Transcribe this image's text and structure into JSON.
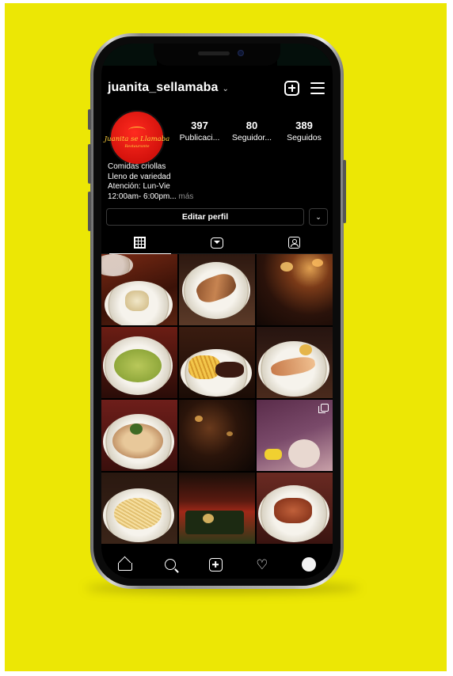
{
  "profile": {
    "username": "juanita_sellamaba",
    "avatar_logo_text": "Juanita se Llamaba",
    "avatar_logo_sub": "Restaurante",
    "brand_color": "#e3150e"
  },
  "stats": [
    {
      "value": "397",
      "label": "Publicaci..."
    },
    {
      "value": "80",
      "label": "Seguidor..."
    },
    {
      "value": "389",
      "label": "Seguidos"
    }
  ],
  "bio": {
    "line1": "Comidas criollas",
    "line2": "Lleno de variedad",
    "line3": "Atención: Lun-Vie",
    "line4": "12:00am- 6:00pm...",
    "more": " más"
  },
  "actions": {
    "edit_profile": "Editar perfil"
  },
  "tabs": [
    {
      "icon": "grid-icon",
      "active": true
    },
    {
      "icon": "igtv-icon",
      "active": false
    },
    {
      "icon": "tagged-icon",
      "active": false
    }
  ],
  "feed": {
    "columns": 3,
    "items": [
      {
        "subject": "rice dish on white plate"
      },
      {
        "subject": "crepes with sauce"
      },
      {
        "subject": "restaurant interior at night"
      },
      {
        "subject": "green risotto"
      },
      {
        "subject": "steak with fries"
      },
      {
        "subject": "fish fillet with potatoes"
      },
      {
        "subject": "tart on plate"
      },
      {
        "subject": "dark bar interior"
      },
      {
        "subject": "event poster",
        "multiple": true
      },
      {
        "subject": "pasta in soup plate"
      },
      {
        "subject": "restaurant storefront"
      },
      {
        "subject": "meat with vegetables"
      }
    ]
  },
  "bottom_nav": [
    "home-icon",
    "search-icon",
    "new-post-icon",
    "activity-icon",
    "profile-avatar"
  ],
  "colors": {
    "background": "#ece705",
    "screen": "#000000",
    "secondary_text": "#8e8e8e"
  }
}
